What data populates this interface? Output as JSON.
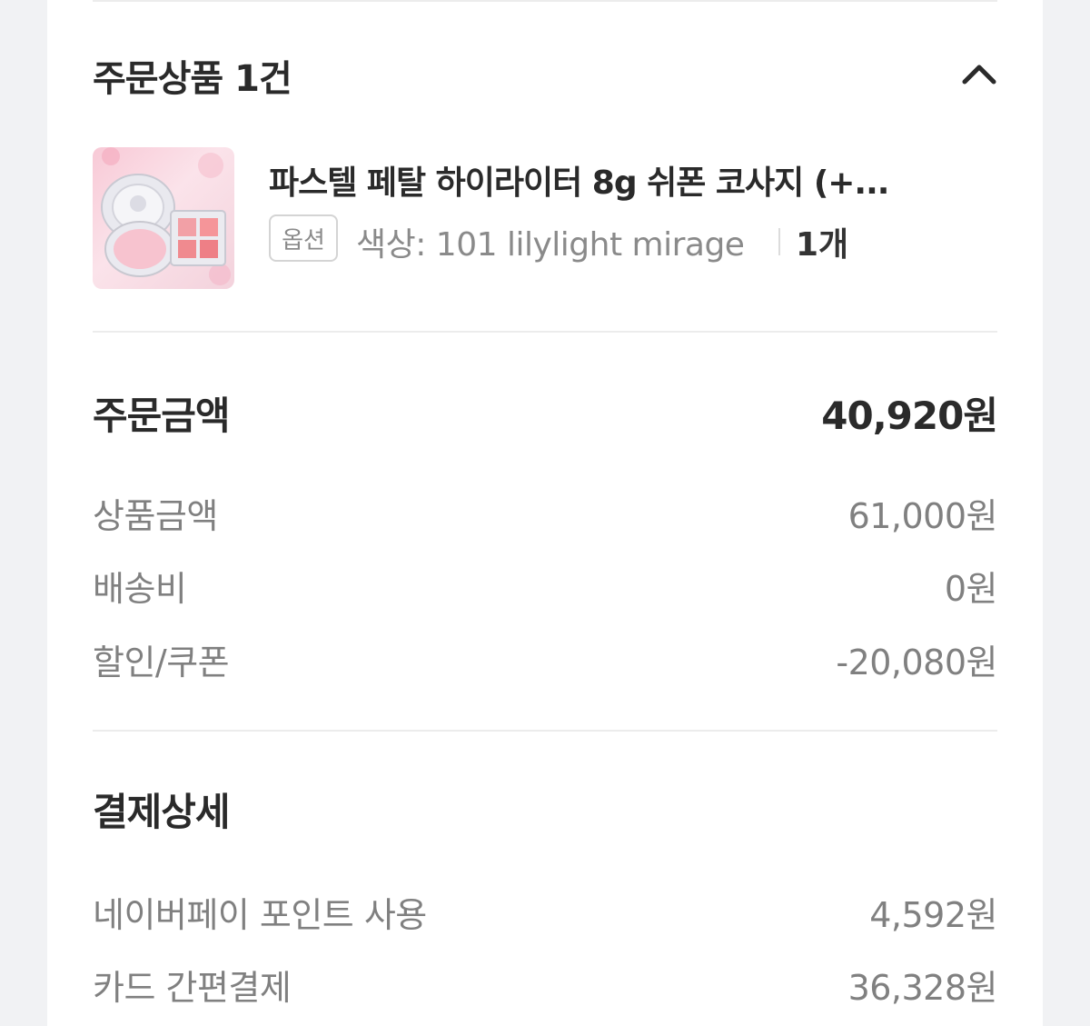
{
  "order_items": {
    "title": "주문상품 1건",
    "expanded_icon": "chevron-up-icon",
    "product": {
      "name": "파스텔 페탈 하이라이터 8g 쉬폰 코사지 (+...",
      "option_badge": "옵션",
      "option_text": "색상: 101 lilylight mirage",
      "quantity": "1개"
    }
  },
  "order_amount": {
    "title": "주문금액",
    "total": "40,920원",
    "lines": [
      {
        "label": "상품금액",
        "value": "61,000원"
      },
      {
        "label": "배송비",
        "value": "0원"
      },
      {
        "label": "할인/쿠폰",
        "value": "-20,080원"
      }
    ]
  },
  "payment_detail": {
    "title": "결제상세",
    "lines": [
      {
        "label": "네이버페이 포인트 사용",
        "value": "4,592원"
      },
      {
        "label": "카드 간편결제",
        "value": "36,328원"
      }
    ]
  },
  "colors": {
    "page_bg": "#f1f2f4",
    "card_bg": "#ffffff",
    "text_primary": "#2a2a2a",
    "text_secondary": "#808080",
    "divider": "#ececec"
  }
}
